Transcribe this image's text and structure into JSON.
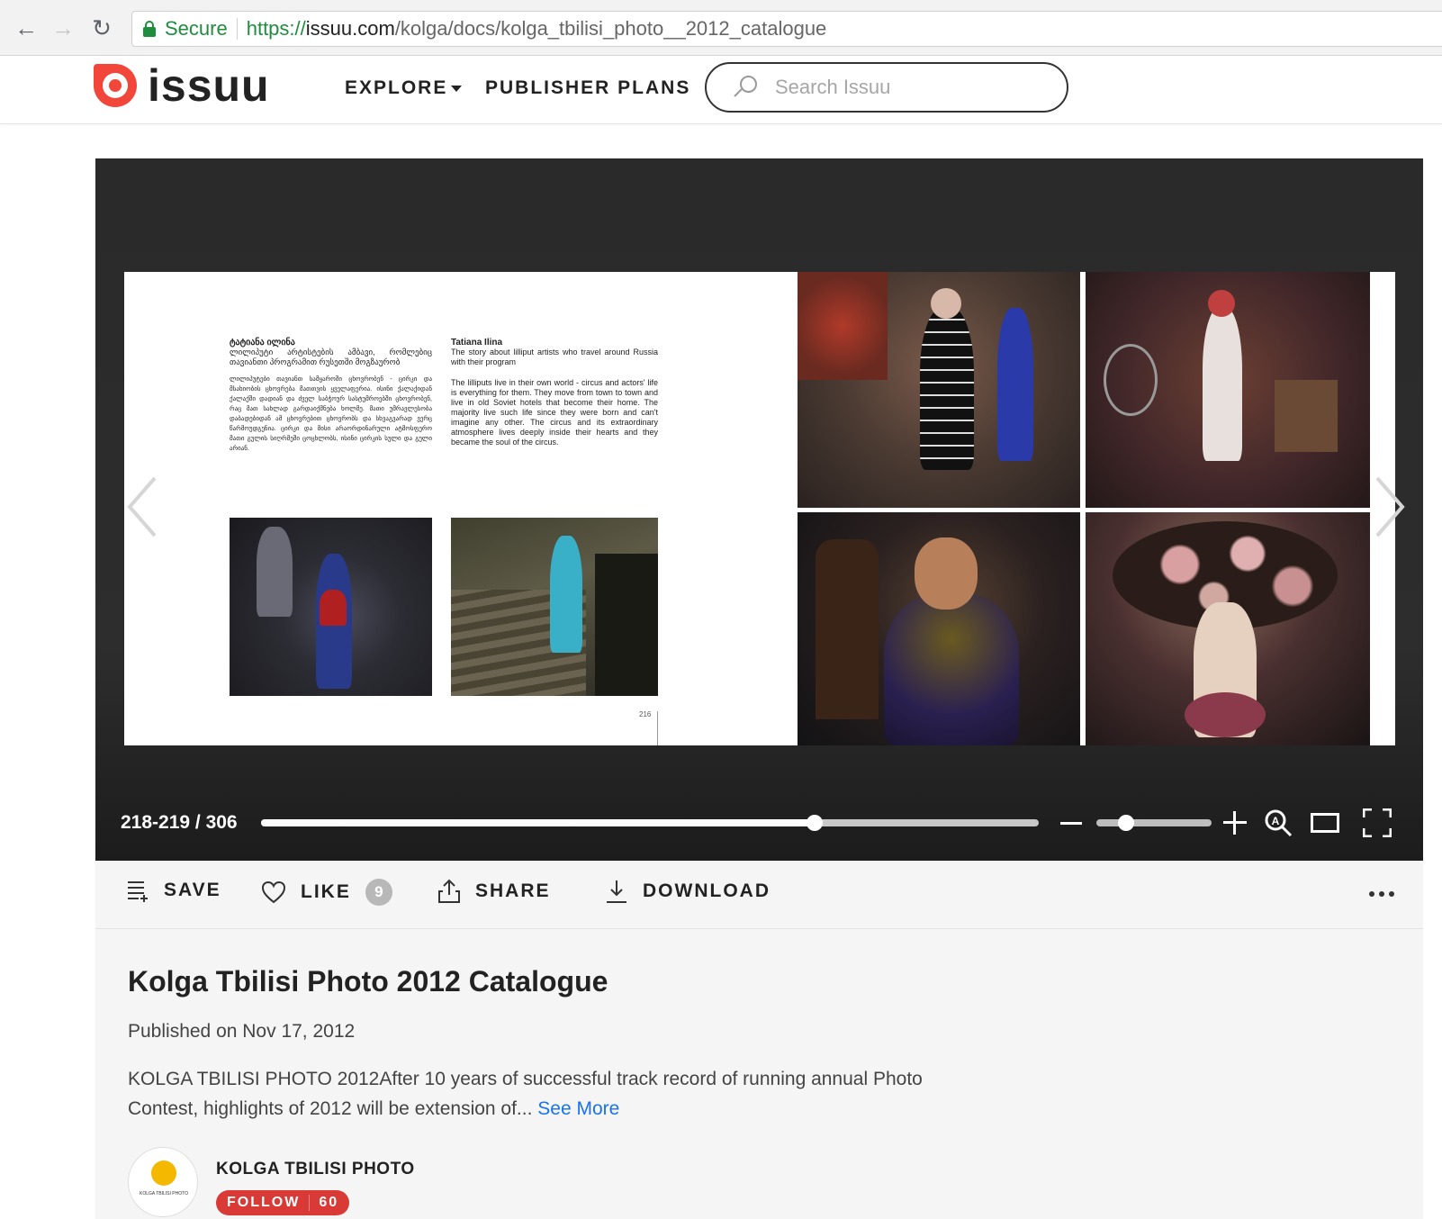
{
  "browser": {
    "secure_label": "Secure",
    "url_scheme": "https://",
    "url_host": "issuu.com",
    "url_path": "/kolga/docs/kolga_tbilisi_photo__2012_catalogue"
  },
  "header": {
    "logo_text": "issuu",
    "menu": {
      "explore": "EXPLORE",
      "publisher_plans": "PUBLISHER PLANS"
    },
    "search_placeholder": "Search Issuu",
    "brand_color": "#f2463a"
  },
  "reader": {
    "left_page": {
      "georgian_heading": "ტატიანა ილინა",
      "georgian_sub": "ლილიპუტი არტისტების ამბავი, რომლებიც თავიანთი პროგრამით რუსეთში მოგზაურობ",
      "georgian_body": "ლილიპუტები თავიანთ სამყაროში ცხოვრობენ - ცირკი და მსახიობის ცხოვრება მათთვის ყველაფერია. ისინი ქალაქიდან ქალაქში დადიან და ძველ საბჭოურ სასტუმროებში ცხოვრობენ, რაც მათ სახლად გარდაიქმნება ხოლმე. მათი უმრავლესობა დაბადებიდან ამ ცხოვრებით ცხოვრობს და სხვაგვარად ვერც წარმოუდგენია. ცირკი და მისი არაორდინარული ატმოსფერო მათი გულის სიღრმეში ცოცხლობს, ისინი ცირკის სული და გული არიან.",
      "english_heading": "Tatiana Ilina",
      "english_sub": "The story about lilliput artists who travel around Russia with their program",
      "english_body": "The lilliputs live in their own world - circus and actors' life is everything for them. They move from town to town and live in old Soviet hotels that become their home. The majority live such life since they were born and can't imagine any other. The circus and its extraordinary atmosphere lives deeply inside their hearts and they became the soul of the circus.",
      "page_number": "216"
    },
    "page_count": "218-219 / 306",
    "progress_fraction": 0.712,
    "zoom_fraction": 0.26
  },
  "actions": {
    "save": "SAVE",
    "like": "LIKE",
    "like_count": "9",
    "share": "SHARE",
    "download": "DOWNLOAD"
  },
  "doc": {
    "title": "Kolga Tbilisi Photo 2012 Catalogue",
    "published": "Published on Nov 17, 2012",
    "description": "KOLGA TBILISI PHOTO 2012After 10 years of successful track record of running annual Photo Contest, highlights of 2012 will be extension of...",
    "see_more": "See More",
    "publisher_name": "KOLGA TBILISI PHOTO",
    "follow_label": "FOLLOW",
    "follow_count": "60",
    "avatar_text": "KOLGA TBILISI PHOTO",
    "follow_color": "#d93a35"
  }
}
